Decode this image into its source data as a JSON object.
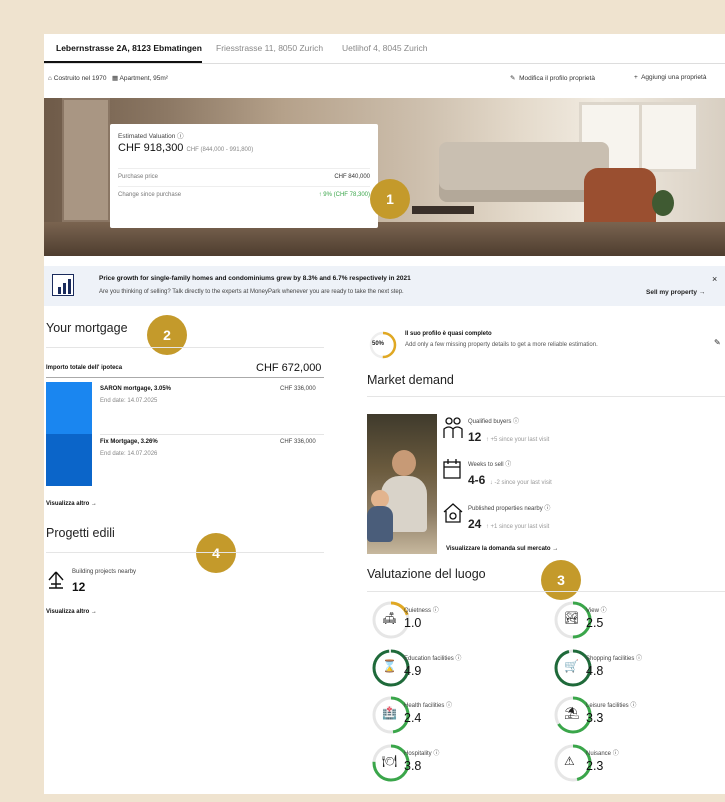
{
  "tabs": [
    {
      "label": "Lebernstrasse 2A, 8123 Ebmatingen",
      "active": true
    },
    {
      "label": "Friesstrasse 11, 8050 Zurich",
      "active": false
    },
    {
      "label": "Uetlihof 4, 8045 Zurich",
      "active": false
    }
  ],
  "meta": {
    "built": "Costruito nel 1970",
    "apartment": "Apartment, 95m²",
    "edit_profile": "Modifica il profilo proprietà",
    "add_property": "Aggiungi una proprietà"
  },
  "valuation": {
    "label": "Estimated Valuation",
    "value": "CHF 918,300",
    "range": "CHF (844,000 - 991,800)",
    "purchase_label": "Purchase price",
    "purchase_value": "CHF 840,000",
    "change_label": "Change since purchase",
    "change_value": "↑ 9% (CHF 78,300)"
  },
  "badges": {
    "b1": "1",
    "b2": "2",
    "b3": "3",
    "b4": "4"
  },
  "banner": {
    "title": "Price growth for single-family homes and condominiums grew by 8.3% and 6.7% respectively in 2021",
    "subtitle": "Are you thinking of selling? Talk directly to the experts at MoneyPark whenever you are ready to take the next step.",
    "cta": "Sell my property →",
    "close": "×"
  },
  "mortgage": {
    "title": "Your mortgage",
    "total_label": "Importo totale dell' ipoteca",
    "total_value": "CHF 672,000",
    "items": [
      {
        "name": "SARON mortgage, 3.05%",
        "end": "End date: 14.07.2025",
        "amount": "CHF 336,000"
      },
      {
        "name": "Fix Mortgage, 3.26%",
        "end": "End date: 14.07.2026",
        "amount": "CHF 336,000"
      }
    ],
    "more": "Visualizza altro →"
  },
  "projects": {
    "title": "Progetti edili",
    "label": "Building projects nearby",
    "value": "12",
    "more": "Visualizza altro →"
  },
  "profile": {
    "percent": "50%",
    "percent_value": 50,
    "title": "Il suo profilo è quasi completo",
    "subtitle": "Add only a few missing property details to get a more reliable estimation."
  },
  "demand": {
    "title": "Market demand",
    "items": [
      {
        "label": "Qualified buyers",
        "value": "12",
        "delta": "↑ +5 since your last visit"
      },
      {
        "label": "Weeks to sell",
        "value": "4-6",
        "delta": "↓ -2 since your last visit"
      },
      {
        "label": "Published properties nearby",
        "value": "24",
        "delta": "↑ +1 since your last visit"
      }
    ],
    "cta": "Visualizzare la domanda sul mercato →"
  },
  "location": {
    "title": "Valutazione del luogo",
    "items": [
      {
        "label": "Quietness",
        "value": "1.0",
        "score": 1.0
      },
      {
        "label": "View",
        "value": "2.5",
        "score": 2.5
      },
      {
        "label": "Education facilities",
        "value": "4.9",
        "score": 4.9
      },
      {
        "label": "Shopping facilities",
        "value": "4.8",
        "score": 4.8
      },
      {
        "label": "Health facilities",
        "value": "2.4",
        "score": 2.4
      },
      {
        "label": "Leisure facilities",
        "value": "3.3",
        "score": 3.3
      },
      {
        "label": "Hospitality",
        "value": "3.8",
        "score": 3.8
      },
      {
        "label": "Nuisance",
        "value": "2.3",
        "score": 2.3
      }
    ]
  },
  "colors": {
    "accent": "#c49a2b",
    "green": "#3aa64a",
    "blue": "#1a86f0",
    "dark_green": "#1f6a3a"
  }
}
